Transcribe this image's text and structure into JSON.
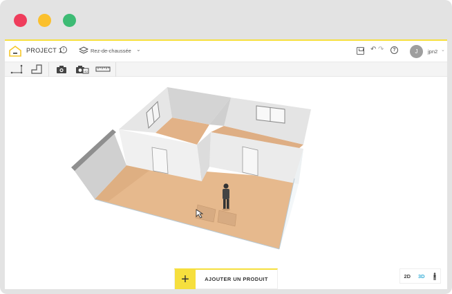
{
  "window": {
    "controls": [
      "close",
      "minimize",
      "maximize"
    ]
  },
  "header": {
    "project_title": "PROJECT 1",
    "info_glyph": "i",
    "level_label": "Rez-de-chaussée",
    "level_chevron": "⌄",
    "undo_glyph": "↶",
    "redo_glyph": "↷",
    "help_glyph": "?",
    "user_initial": "J",
    "username": "jpn2",
    "user_chevron": "⌄"
  },
  "toolbar": {
    "tools": [
      "wall-tool-icon",
      "room-tool-icon",
      "camera-icon",
      "photo-render-icon",
      "ruler-icon"
    ]
  },
  "viewport": {
    "add_product_plus": "+",
    "add_product_label": "AJOUTER UN PRODUIT",
    "zoom_in": "+",
    "zoom_out": "-",
    "view_2d": "2D",
    "view_3d": "3D",
    "active_view": "3D"
  },
  "colors": {
    "accent": "#f6df3d",
    "active_view": "#3cb0d8",
    "floor": "#e7b88a",
    "wall": "#dcdcdc"
  }
}
